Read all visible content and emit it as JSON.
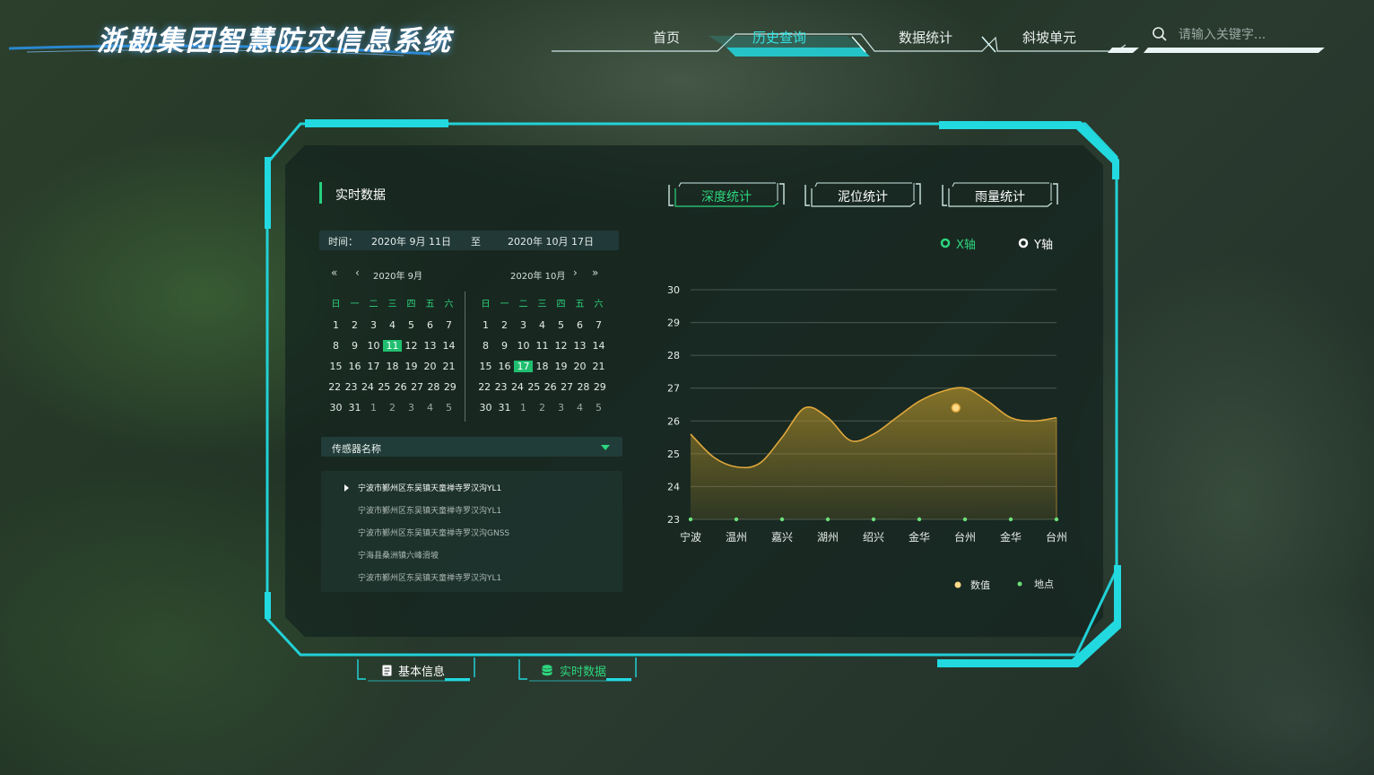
{
  "header": {
    "title": "浙勘集团智慧防灾信息系统",
    "nav": [
      "首页",
      "历史查询",
      "数据统计",
      "斜坡单元"
    ],
    "active_nav": "历史查询",
    "search_placeholder": "请输入关键字..."
  },
  "panel": {
    "section_title": "实时数据",
    "time_label": "时间：",
    "start_date": "2020年 9月 11日",
    "to_label": "至",
    "end_date": "2020年 10月 17日",
    "calendars": [
      {
        "month_label": "2020年 9月",
        "weekdays": [
          "日",
          "一",
          "二",
          "三",
          "四",
          "五",
          "六"
        ],
        "weeks": [
          [
            "1",
            "2",
            "3",
            "4",
            "5",
            "6",
            "7"
          ],
          [
            "8",
            "9",
            "10",
            "11",
            "12",
            "13",
            "14"
          ],
          [
            "15",
            "16",
            "17",
            "18",
            "19",
            "20",
            "21"
          ],
          [
            "22",
            "23",
            "24",
            "25",
            "26",
            "27",
            "28",
            "29"
          ],
          [
            "30",
            "31",
            "1",
            "2",
            "3",
            "4",
            "5"
          ]
        ],
        "selected_day": "11"
      },
      {
        "month_label": "2020年 10月",
        "weekdays": [
          "日",
          "一",
          "二",
          "三",
          "四",
          "五",
          "六"
        ],
        "weeks": [
          [
            "1",
            "2",
            "3",
            "4",
            "5",
            "6",
            "7"
          ],
          [
            "8",
            "9",
            "10",
            "11",
            "12",
            "13",
            "14"
          ],
          [
            "15",
            "16",
            "17",
            "18",
            "19",
            "20",
            "21"
          ],
          [
            "22",
            "23",
            "24",
            "25",
            "26",
            "27",
            "28",
            "29"
          ],
          [
            "30",
            "31",
            "1",
            "2",
            "3",
            "4",
            "5"
          ]
        ],
        "selected_day": "17"
      }
    ],
    "calendar_nav": {
      "prev_year": "«",
      "prev_month": "‹",
      "next_month": "›",
      "next_year": "»"
    },
    "sensor_select_label": "传感器名称",
    "sensors": [
      "宁波市鄞州区东吴镇天童禅寺罗汉沟YL1",
      "宁波市鄞州区东吴镇天童禅寺罗汉沟YL1",
      "宁波市鄞州区东吴镇天童禅寺罗汉沟GNSS",
      "宁海县桑洲镇六峰滑坡",
      "宁波市鄞州区东吴镇天童禅寺罗汉沟YL1"
    ],
    "active_sensor_index": 0,
    "stat_tabs": [
      "深度统计",
      "泥位统计",
      "雨量统计"
    ],
    "active_stat_tab": 0,
    "axis_toggle": [
      "X轴",
      "Y轴"
    ],
    "active_axis": 0
  },
  "chart_data": {
    "type": "area",
    "categories": [
      "宁波",
      "温州",
      "嘉兴",
      "湖州",
      "绍兴",
      "金华",
      "台州",
      "金华",
      "台州"
    ],
    "series": [
      {
        "name": "数值",
        "x": [
          0,
          0.5,
          1,
          1.5,
          2,
          2.5,
          3,
          3.5,
          4,
          4.5,
          5,
          5.5,
          6,
          6.5,
          7,
          7.5,
          8
        ],
        "values": [
          25.6,
          24.9,
          24.6,
          24.7,
          25.5,
          26.4,
          26.1,
          25.4,
          25.6,
          26.1,
          26.6,
          26.9,
          27.0,
          26.6,
          26.1,
          26.0,
          26.1
        ]
      }
    ],
    "ylim": [
      23,
      30
    ],
    "yticks": [
      23,
      24,
      25,
      26,
      27,
      28,
      29,
      30
    ],
    "highlight": {
      "x": 5.8,
      "y": 26.4
    },
    "legend": [
      "数值",
      "地点"
    ],
    "legend_position": "bottom-right",
    "grid": true,
    "colors": {
      "line": "#e0a83a",
      "fill": "#a88a2a",
      "point": "#6ce07a"
    }
  },
  "bottom_tabs": [
    "基本信息",
    "实时数据"
  ],
  "active_bottom_tab": 1,
  "colors": {
    "accent": "#22d9e0",
    "green": "#25d07f",
    "orange": "#e0a83a"
  }
}
